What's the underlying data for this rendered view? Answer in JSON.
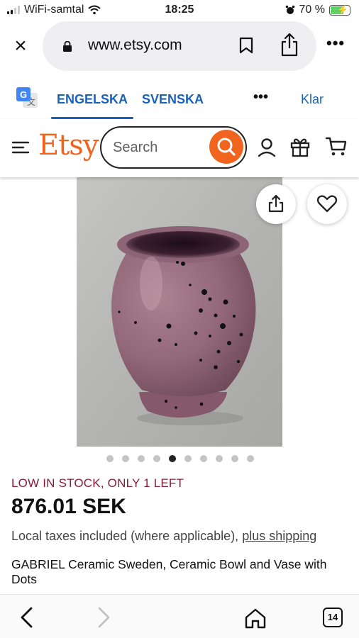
{
  "status_bar": {
    "carrier": "WiFi-samtal",
    "time": "18:25",
    "battery": "70 %",
    "battery_level": 0.7
  },
  "browser": {
    "url": "www.etsy.com"
  },
  "translate": {
    "tab_english": "ENGELSKA",
    "tab_swedish": "SVENSKA",
    "more": "•••",
    "done": "Klar"
  },
  "header": {
    "logo": "Etsy",
    "search_placeholder": "Search"
  },
  "gallery": {
    "image_count": 10,
    "active_index": 4
  },
  "listing": {
    "stock": "LOW IN STOCK, ONLY 1 LEFT",
    "price": "876.01 SEK",
    "taxes": "Local taxes included (where applicable), ",
    "shipping_link": "plus shipping",
    "title": "GABRIEL Ceramic Sweden, Ceramic Bowl and Vase with Dots"
  },
  "toolbar": {
    "tab_count": "14"
  },
  "colors": {
    "etsy_orange": "#f1641e",
    "translate_blue": "#1a62b8",
    "stock_red": "#8b1a3a"
  }
}
